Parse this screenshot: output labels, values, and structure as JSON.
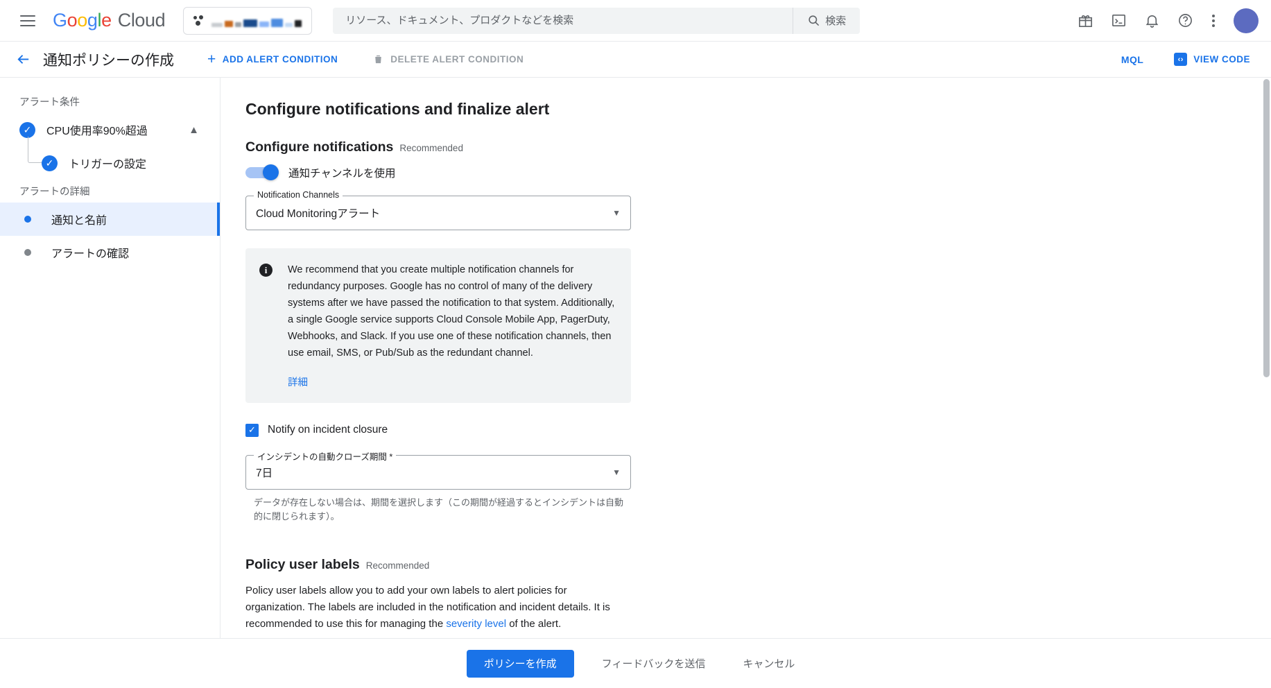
{
  "header": {
    "menu_icon": "hamburger-icon",
    "logo": {
      "google": "Google",
      "cloud": "Cloud"
    },
    "project_selector": {
      "label": "",
      "icon": "project-dots-icon"
    },
    "search": {
      "placeholder": "リソース、ドキュメント、プロダクトなどを検索",
      "value": "",
      "button_label": "検索",
      "button_icon": "search-icon"
    },
    "actions": [
      {
        "name": "gift-icon",
        "glyph": "gift"
      },
      {
        "name": "cloud-shell-icon",
        "glyph": "terminal"
      },
      {
        "name": "notifications-bell-icon",
        "glyph": "bell"
      },
      {
        "name": "help-icon",
        "glyph": "question"
      },
      {
        "name": "more-options-icon",
        "glyph": "kebab"
      }
    ],
    "avatar_color": "#5c6bc0"
  },
  "toolbar": {
    "back_icon": "arrow-back-icon",
    "title": "通知ポリシーの作成",
    "add_alert_condition": "ADD ALERT CONDITION",
    "delete_alert_condition": "DELETE ALERT CONDITION",
    "mql": "MQL",
    "view_code": "VIEW CODE"
  },
  "sidebar": {
    "section_alert_conditions": "アラート条件",
    "condition": {
      "label": "CPU使用率90%超過",
      "completed": true,
      "expanded": true,
      "child": {
        "label": "トリガーの設定",
        "completed": true
      }
    },
    "section_alert_details": "アラートの詳細",
    "steps": [
      {
        "label": "通知と名前",
        "active": true
      },
      {
        "label": "アラートの確認",
        "active": false
      }
    ]
  },
  "main": {
    "page_heading": "Configure notifications and finalize alert",
    "configure_notifications": {
      "heading": "Configure notifications",
      "badge": "Recommended",
      "toggle_label": "通知チャンネルを使用",
      "toggle_on": true,
      "channels_field": {
        "legend": "Notification Channels",
        "value": "Cloud Monitoringアラート"
      },
      "info": {
        "icon": "info-icon",
        "text": "We recommend that you create multiple notification channels for redundancy purposes. Google has no control of many of the delivery systems after we have passed the notification to that system. Additionally, a single Google service supports Cloud Console Mobile App, PagerDuty, Webhooks, and Slack. If you use one of these notification channels, then use email, SMS, or Pub/Sub as the redundant channel.",
        "link": "詳細"
      },
      "notify_closure": {
        "label": "Notify on incident closure",
        "checked": true
      },
      "auto_close_field": {
        "legend": "インシデントの自動クローズ期間 *",
        "value": "7日"
      },
      "auto_close_helper": "データが存在しない場合は、期間を選択します（この期間が経過するとインシデントは自動的に閉じられます）。"
    },
    "policy_user_labels": {
      "heading": "Policy user labels",
      "badge": "Recommended",
      "description_part1": "Policy user labels allow you to add your own labels to alert policies for organization. The labels are included in the notification and incident details. It is recommended to use this for managing the ",
      "description_link": "severity level",
      "description_part2": " of the alert."
    }
  },
  "bottom_bar": {
    "create_policy": "ポリシーを作成",
    "send_feedback": "フィードバックを送信",
    "cancel": "キャンセル"
  },
  "colors": {
    "accent_blue": "#1a73e8",
    "active_bg": "#e8f0fe",
    "muted": "#5f6368"
  }
}
